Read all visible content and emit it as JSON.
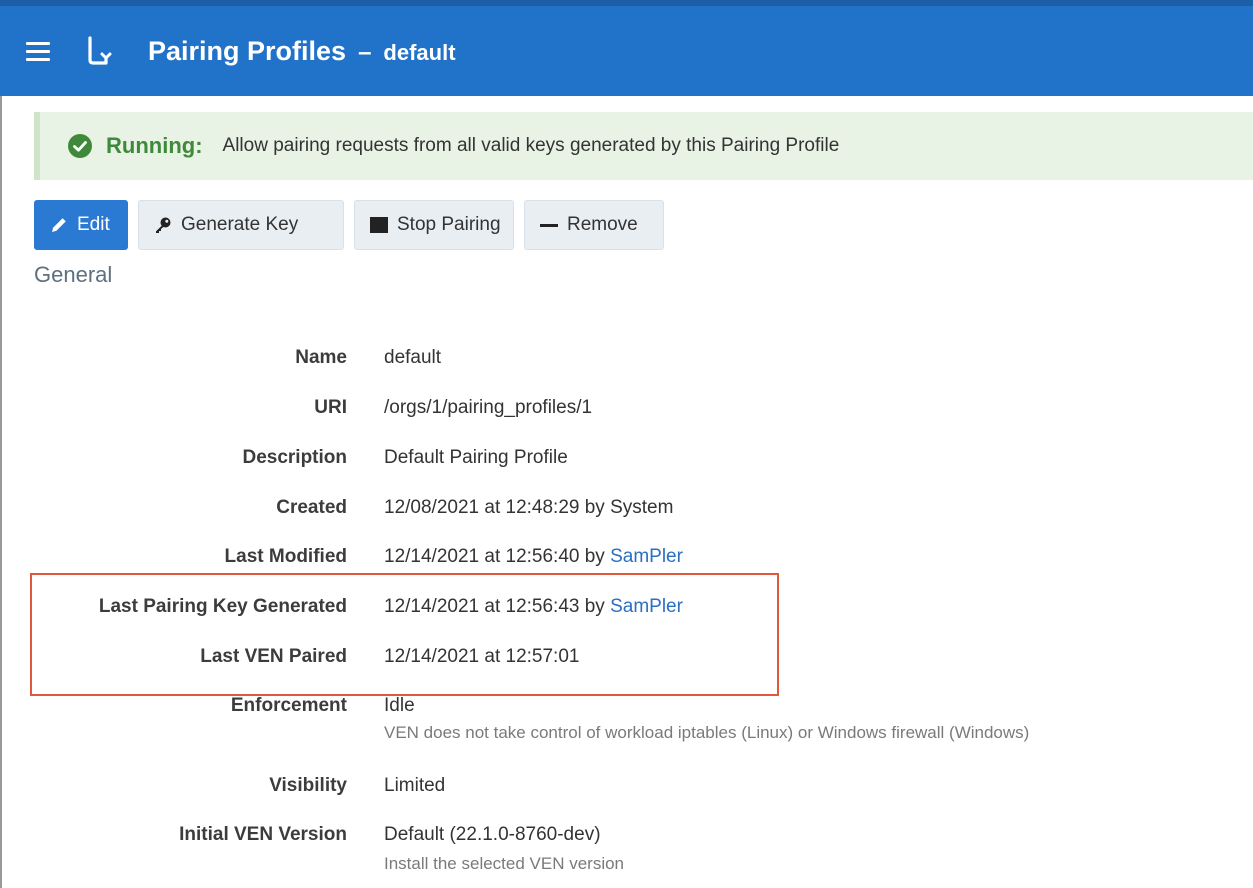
{
  "header": {
    "title": "Pairing Profiles",
    "separator": "–",
    "subtitle": "default"
  },
  "banner": {
    "status": "Running:",
    "message": "Allow pairing requests from all valid keys generated by this Pairing Profile",
    "color": "#3f8a3a"
  },
  "toolbar": {
    "edit_label": "Edit",
    "generate_key_label": "Generate Key",
    "stop_pairing_label": "Stop Pairing",
    "remove_label": "Remove"
  },
  "general": {
    "section_title": "General",
    "name_label": "Name",
    "name_value": "default",
    "uri_label": "URI",
    "uri_value": "/orgs/1/pairing_profiles/1",
    "description_label": "Description",
    "description_value": "Default Pairing Profile",
    "created_label": "Created",
    "created_value": "12/08/2021 at 12:48:29 by System",
    "last_modified_label": "Last Modified",
    "last_modified_value": "12/14/2021 at 12:56:40 by ",
    "last_modified_user": "SamPler",
    "last_key_label": "Last Pairing Key Generated",
    "last_key_value": "12/14/2021 at 12:56:43 by ",
    "last_key_user": "SamPler",
    "last_ven_label": "Last VEN Paired",
    "last_ven_value": "12/14/2021 at 12:57:01",
    "enforcement_label": "Enforcement",
    "enforcement_value": "Idle",
    "enforcement_hint": "VEN does not take control of workload iptables (Linux) or Windows firewall (Windows)",
    "visibility_label": "Visibility",
    "visibility_value": "Limited",
    "initial_ven_label": "Initial VEN Version",
    "initial_ven_value": "Default (22.1.0-8760-dev)",
    "initial_ven_hint": "Install the selected VEN version"
  },
  "colors": {
    "header_bg": "#2173c9",
    "primary_button": "#2a7ad3",
    "link": "#2a6fc2",
    "highlight_border": "#e2583c"
  },
  "icons": {
    "menu": "hamburger-menu-icon",
    "back": "back-arrow-icon",
    "status": "check-circle-icon",
    "edit": "pencil-icon",
    "generate_key": "key-icon",
    "stop": "stop-square-icon",
    "remove": "minus-icon"
  }
}
